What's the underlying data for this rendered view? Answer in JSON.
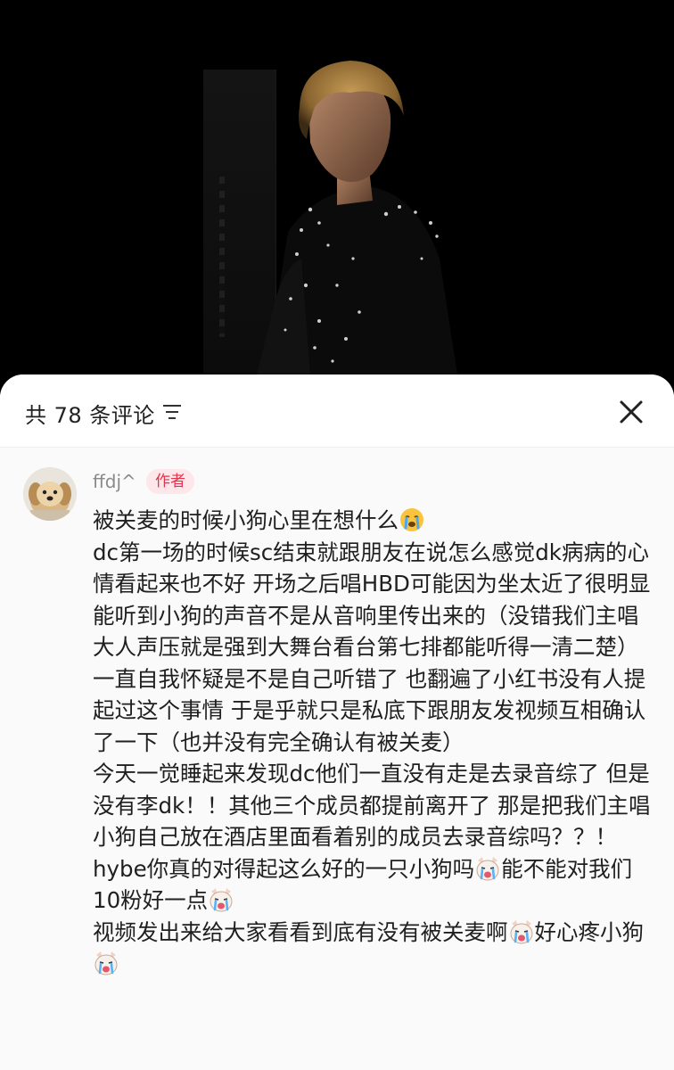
{
  "header": {
    "comment_count_label": "共 78 条评论"
  },
  "comment": {
    "username": "ffdj^",
    "author_badge": "作者",
    "p1": "被关麦的时候小狗心里在想什么",
    "p2": "dc第一场的时候sc结束就跟朋友在说怎么感觉dk病病的心情看起来也不好 开场之后唱HBD可能因为坐太近了很明显能听到小狗的声音不是从音响里传出来的（没错我们主唱大人声压就是强到大舞台看台第七排都能听得一清二楚）一直自我怀疑是不是自己听错了 也翻遍了小红书没有人提起过这个事情 于是乎就只是私底下跟朋友发视频互相确认了一下（也并没有完全确认有被关麦）",
    "p3a": "今天一觉睡起来发现dc他们一直没有走是去录音综了 但是没有李dk！！其他三个成员都提前离开了 那是把我们主唱小狗自己放在酒店里面看着别的成员去录音综吗？？！hybe你真的对得起这么好的一只小狗吗",
    "p3b": "能不能对我们10粉好一点",
    "p4a": "视频发出来给大家看看到底有没有被关麦啊",
    "p4b": "好心疼小狗"
  },
  "colors": {
    "badge_bg": "#fde7ea",
    "badge_text": "#e3344c",
    "username": "#8a8a8a"
  },
  "icons": [
    "filter-icon",
    "close-icon",
    "crying-face-emoji",
    "crying-dog-emoji"
  ]
}
